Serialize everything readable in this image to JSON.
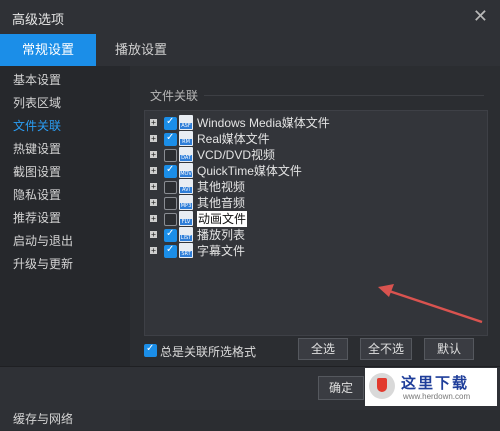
{
  "window": {
    "title": "高级选项"
  },
  "tabs": [
    {
      "label": "常规设置",
      "active": true
    },
    {
      "label": "播放设置",
      "active": false
    }
  ],
  "sidebar": {
    "items": [
      {
        "label": "基本设置"
      },
      {
        "label": "列表区域"
      },
      {
        "label": "文件关联",
        "active": true
      },
      {
        "label": "热键设置"
      },
      {
        "label": "截图设置"
      },
      {
        "label": "隐私设置"
      },
      {
        "label": "推荐设置"
      },
      {
        "label": "启动与退出"
      },
      {
        "label": "升级与更新"
      }
    ],
    "bottom_label": "缓存与网络"
  },
  "file_assoc": {
    "group_label": "文件关联",
    "rows": [
      {
        "label": "Windows Media媒体文件",
        "checked": true,
        "icon": "asf-file-icon",
        "tag": "ASF"
      },
      {
        "label": "Real媒体文件",
        "checked": true,
        "icon": "rm-file-icon",
        "tag": "RM"
      },
      {
        "label": "VCD/DVD视频",
        "checked": false,
        "icon": "dat-file-icon",
        "tag": "DAT"
      },
      {
        "label": "QuickTime媒体文件",
        "checked": true,
        "icon": "mov-file-icon",
        "tag": "MOV"
      },
      {
        "label": "其他视频",
        "checked": false,
        "icon": "video-file-icon",
        "tag": "AVI"
      },
      {
        "label": "其他音频",
        "checked": false,
        "icon": "audio-file-icon",
        "tag": "MP3"
      },
      {
        "label": "动画文件",
        "checked": false,
        "icon": "flv-file-icon",
        "tag": "FLV",
        "highlighted": true
      },
      {
        "label": "播放列表",
        "checked": true,
        "icon": "list-file-icon",
        "tag": "LIST"
      },
      {
        "label": "字幕文件",
        "checked": true,
        "icon": "srt-file-icon",
        "tag": "SRT"
      }
    ],
    "always_assoc_label": "总是关联所选格式",
    "always_assoc_checked": true,
    "btn_select_all": "全选",
    "btn_select_none": "全不选",
    "btn_default": "默认"
  },
  "footer": {
    "ok_label": "确定"
  },
  "watermark": {
    "text": "这里下载",
    "url": "www.herdown.com"
  },
  "colors": {
    "accent": "#1b8ee8",
    "annotation": "#d9534f"
  }
}
